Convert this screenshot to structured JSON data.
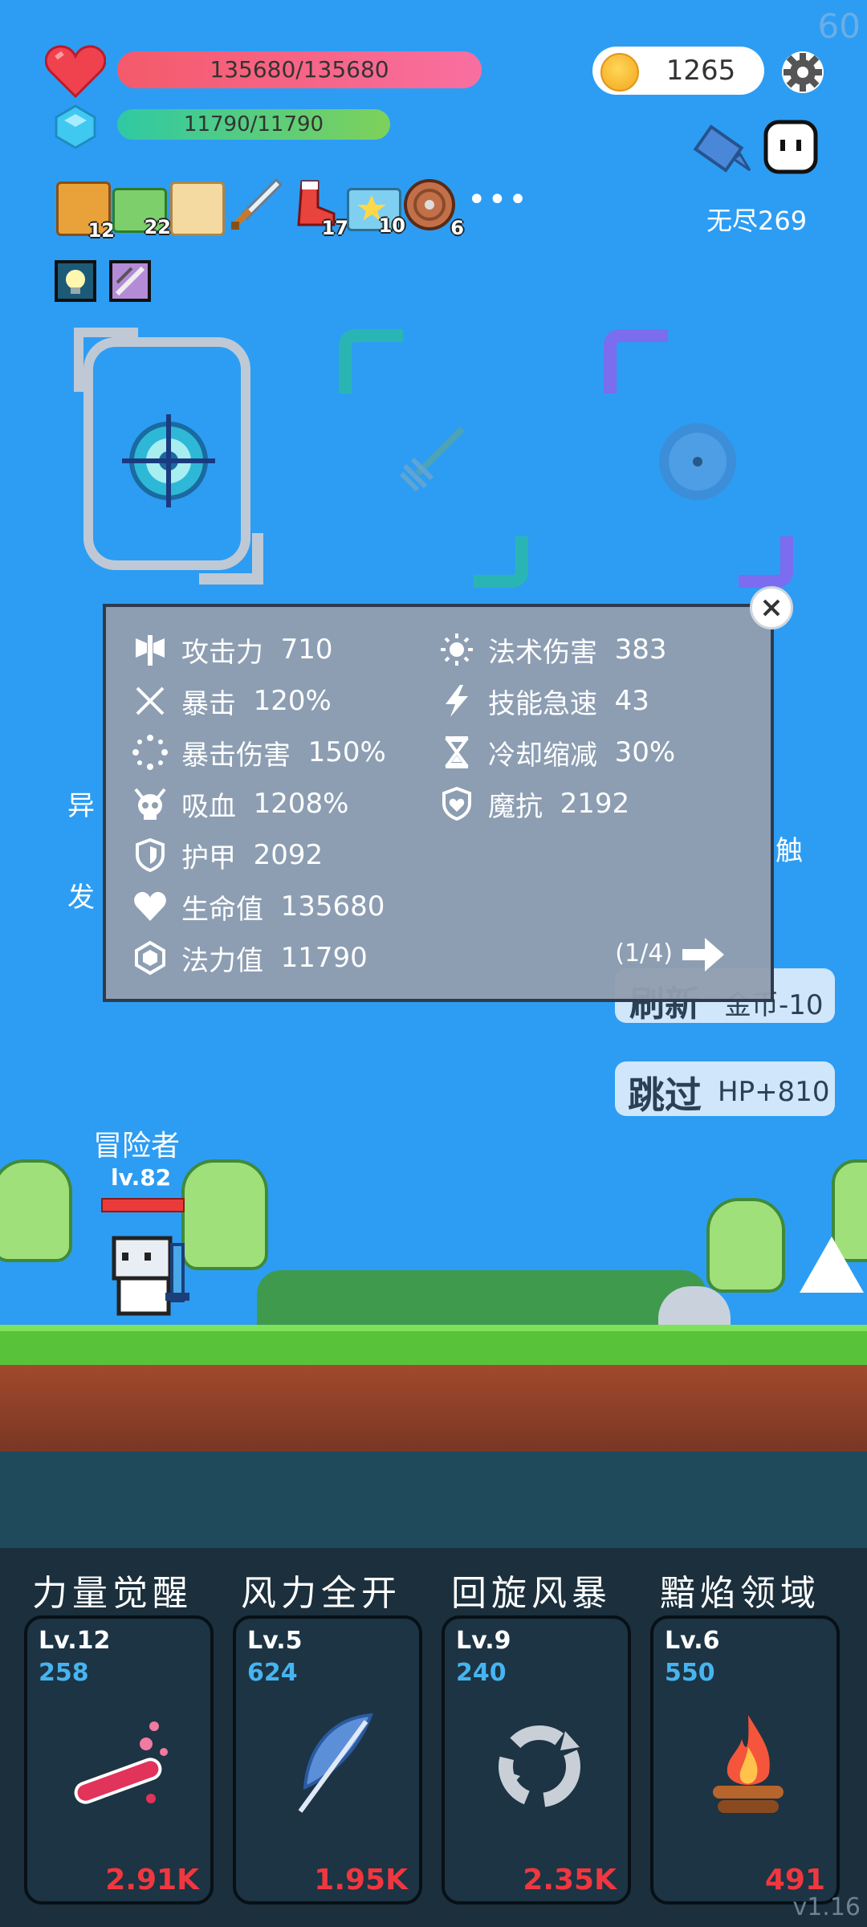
{
  "fps": "60",
  "player": {
    "hp_text": "135680/135680",
    "mp_text": "11790/11790",
    "coins": "1265",
    "mode_label": "无尽269"
  },
  "inventory": [
    {
      "icon": "book-icon",
      "count": "12"
    },
    {
      "icon": "cash-icon",
      "count": "22"
    },
    {
      "icon": "scroll-icon",
      "count": ""
    },
    {
      "icon": "sword-icon",
      "count": ""
    },
    {
      "icon": "boot-icon",
      "count": "17"
    },
    {
      "icon": "star-card-icon",
      "count": "10"
    },
    {
      "icon": "shield-round-icon",
      "count": "6"
    }
  ],
  "stats_popup": {
    "left": [
      {
        "icon": "axe-icon",
        "label": "攻击力",
        "value": "710"
      },
      {
        "icon": "crossed-swords-icon",
        "label": "暴击",
        "value": "120%"
      },
      {
        "icon": "dotted-circle-icon",
        "label": "暴击伤害",
        "value": "150%"
      },
      {
        "icon": "skull-icon",
        "label": "吸血",
        "value": "1208%"
      },
      {
        "icon": "shield-icon",
        "label": "护甲",
        "value": "2092"
      },
      {
        "icon": "heart-icon",
        "label": "生命值",
        "value": "135680"
      },
      {
        "icon": "crystal-icon",
        "label": "法力值",
        "value": "11790"
      }
    ],
    "right": [
      {
        "icon": "sun-icon",
        "label": "法术伤害",
        "value": "383"
      },
      {
        "icon": "lightning-icon",
        "label": "技能急速",
        "value": "43"
      },
      {
        "icon": "hourglass-icon",
        "label": "冷却缩减",
        "value": "30%"
      },
      {
        "icon": "heart-shield-icon",
        "label": "魔抗",
        "value": "2192"
      }
    ],
    "page_indicator": "(1/4)"
  },
  "behind_popup": {
    "left_top": "异",
    "left_bottom": "发",
    "right_mid": "触",
    "refresh_big": "刷新",
    "refresh_small": "金币-10",
    "skip_big": "跳过",
    "skip_small": "HP+810"
  },
  "hero": {
    "name": "冒险者",
    "level": "lv.82"
  },
  "skills": [
    {
      "title": "力量觉醒",
      "level": "Lv.12",
      "cost": "258",
      "damage": "2.91K",
      "icon": "potion-icon"
    },
    {
      "title": "风力全开",
      "level": "Lv.5",
      "cost": "624",
      "damage": "1.95K",
      "icon": "feather-icon"
    },
    {
      "title": "回旋风暴",
      "level": "Lv.9",
      "cost": "240",
      "damage": "2.35K",
      "icon": "cycle-icon"
    },
    {
      "title": "黯焰领域",
      "level": "Lv.6",
      "cost": "550",
      "damage": "491",
      "icon": "campfire-icon"
    }
  ],
  "version": "v1.16"
}
